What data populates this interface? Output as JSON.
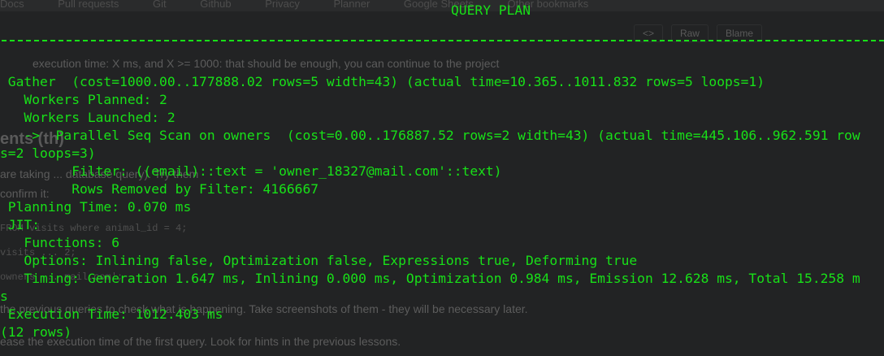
{
  "background": {
    "bookmarks": [
      "Docs",
      "Pull requests",
      "Git",
      "Github",
      "Privacy",
      "Planner",
      "Google Sheets",
      "Other bookmarks"
    ],
    "toolbar": [
      "<>",
      "Raw",
      "Blame"
    ],
    "lines": [
      "execution time: X ms, and X >= 1000: that should be enough, you can continue to the project",
      "ents (th)",
      "are taking ... database query). Try them",
      "confirm it:",
      "FROM visits where animal_id = 4;",
      "visits ... 2;",
      "owners ... mail.com';",
      "the previous queries to check what is happening. Take screenshots of them - they will be necessary later.",
      "ease the execution time of the first query. Look for hints in the previous lessons."
    ]
  },
  "terminal": {
    "header": "QUERY PLAN",
    "lines": [
      " Gather  (cost=1000.00..177888.02 rows=5 width=43) (actual time=10.365..1011.832 rows=5 loops=1)",
      "   Workers Planned: 2",
      "   Workers Launched: 2",
      "   ->  Parallel Seq Scan on owners  (cost=0.00..176887.52 rows=2 width=43) (actual time=445.106..962.591 row",
      "s=2 loops=3)",
      "         Filter: ((email)::text = 'owner_18327@mail.com'::text)",
      "         Rows Removed by Filter: 4166667",
      " Planning Time: 0.070 ms",
      " JIT:",
      "   Functions: 6",
      "   Options: Inlining false, Optimization false, Expressions true, Deforming true",
      "   Timing: Generation 1.647 ms, Inlining 0.000 ms, Optimization 0.984 ms, Emission 12.628 ms, Total 15.258 m",
      "s",
      " Execution Time: 1012.403 ms",
      "(12 rows)"
    ]
  },
  "colors": {
    "terminal_text": "#18e018",
    "terminal_bg": "#222324"
  }
}
